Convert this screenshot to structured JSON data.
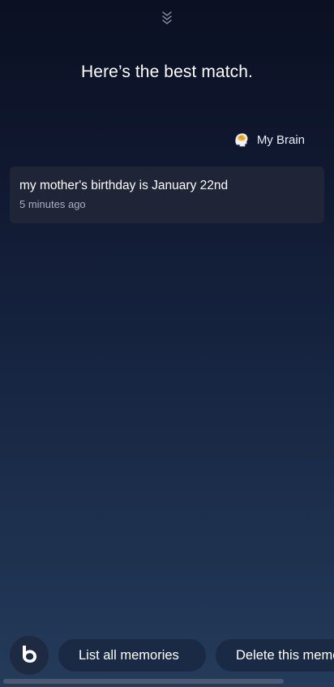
{
  "handle": {
    "icon": "double-chevron-down-icon"
  },
  "headline": "Here’s the best match.",
  "source": {
    "icon": "brain-head-icon",
    "label": "My Brain"
  },
  "memory": {
    "text": "my mother's birthday is January 22nd",
    "time": "5 minutes ago"
  },
  "bottom_bar": {
    "assistant_icon": "bixby-icon",
    "suggestions": [
      {
        "label": "List all memories"
      },
      {
        "label": "Delete this memory"
      }
    ]
  },
  "colors": {
    "background_top": "#0b1022",
    "background_bottom": "#243b5a",
    "card": "#1f2436",
    "chip": "#1a2944",
    "muted_text": "#a8b1c4"
  }
}
